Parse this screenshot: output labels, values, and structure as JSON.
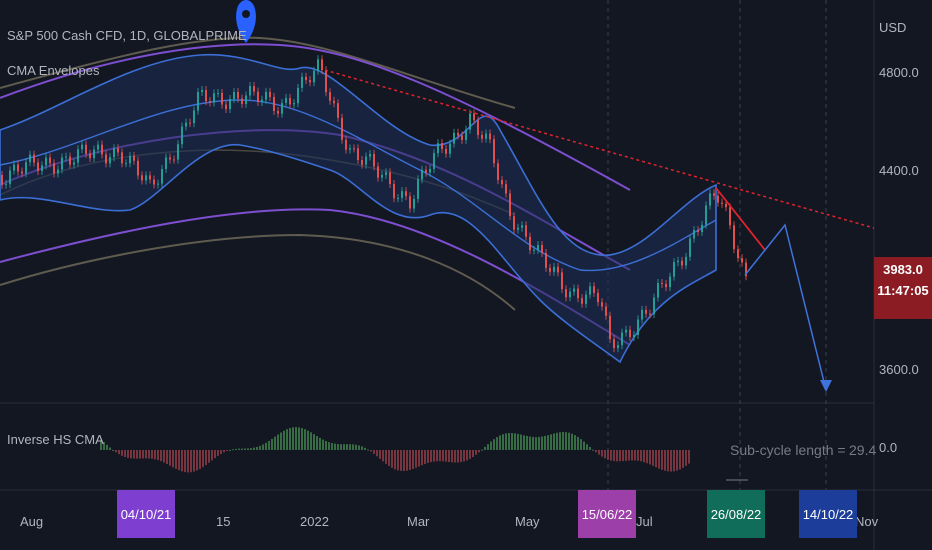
{
  "header": {
    "symbol_title": "S&P 500 Cash CFD, 1D, GLOBALPRIME",
    "indicator_main": "CMA Envelopes",
    "indicator_sub": "Inverse HS CMA",
    "currency": "USD"
  },
  "price_axis": {
    "labels": [
      "4800.0",
      "4400.0",
      "3600.0"
    ],
    "sub_zero": "0.0",
    "current_price": "3983.0",
    "countdown": "11:47:05"
  },
  "time_axis": {
    "labels": [
      "Aug",
      "15",
      "2022",
      "Mar",
      "May",
      "Jul",
      "Nov"
    ]
  },
  "date_tags": [
    {
      "label": "04/10/21",
      "color": "#7e3fd0"
    },
    {
      "label": "15/06/22",
      "color": "#9c3fa8"
    },
    {
      "label": "26/08/22",
      "color": "#106d59"
    },
    {
      "label": "14/10/22",
      "color": "#1c3e9a"
    }
  ],
  "sub_cycle": {
    "label": "Sub-cycle length =",
    "value": "29.4"
  },
  "colors": {
    "background": "#131722",
    "envelope_fill": "#1e2f57",
    "envelope_line": "#3b6fd6",
    "purple_band": "#7d4fd0",
    "gray_band": "#5f5b4f",
    "trendline": "#e0242e",
    "projection": "#3f73db",
    "marker": "#2962ff",
    "price_badge": "#8b1c24"
  }
}
